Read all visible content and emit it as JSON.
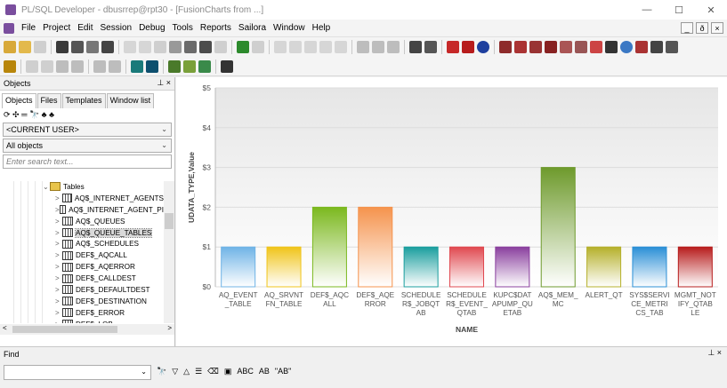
{
  "window": {
    "title": "PL/SQL Developer - dbusrrep@rpt30 - [FusionCharts from ...]"
  },
  "window_controls": [
    "—",
    "☐",
    "✕"
  ],
  "menu": [
    "File",
    "Project",
    "Edit",
    "Session",
    "Debug",
    "Tools",
    "Reports",
    "Sailora",
    "Window",
    "Help"
  ],
  "mdi_controls": [
    "_",
    "ð",
    "×"
  ],
  "objects_panel": {
    "title": "Objects",
    "pin": "⊥ ×",
    "tabs": [
      "Objects",
      "Files",
      "Templates",
      "Window list"
    ],
    "tools": "⟳ ✣ ═ 🔭 ♣ ♣",
    "user_combo": "<CURRENT USER>",
    "filter_combo": "All objects",
    "search_placeholder": "Enter search text...",
    "tree": [
      {
        "label": "Tables",
        "type": "folder",
        "expander": "⌄"
      },
      {
        "label": "AQ$_INTERNET_AGENTS",
        "expander": ">"
      },
      {
        "label": "AQ$_INTERNET_AGENT_PI",
        "expander": ">"
      },
      {
        "label": "AQ$_QUEUES",
        "expander": ">"
      },
      {
        "label": "AQ$_QUEUE_TABLES",
        "expander": ">",
        "selected": true
      },
      {
        "label": "AQ$_SCHEDULES",
        "expander": ">"
      },
      {
        "label": "DEF$_AQCALL",
        "expander": ">"
      },
      {
        "label": "DEF$_AQERROR",
        "expander": ">"
      },
      {
        "label": "DEF$_CALLDEST",
        "expander": ">"
      },
      {
        "label": "DEF$_DEFAULTDEST",
        "expander": ">"
      },
      {
        "label": "DEF$_DESTINATION",
        "expander": ">"
      },
      {
        "label": "DEF$_ERROR",
        "expander": ">"
      },
      {
        "label": "DEF$_LOB",
        "expander": ">"
      }
    ]
  },
  "find_panel": {
    "title": "Find",
    "pin": "⊥ ×",
    "tools": [
      "🔭",
      "▽",
      "△",
      "☰",
      "⌫",
      "▣",
      "ABC",
      "AB",
      "\"AB\""
    ]
  },
  "colors": {
    "grid": "#dcdcdc",
    "axis_text": "#555555",
    "series": [
      "#6fb3e6",
      "#f0c419",
      "#7bb81e",
      "#f5934d",
      "#1a9e9e",
      "#e0484f",
      "#8a3f9e",
      "#6e9a2c",
      "#b5b02a",
      "#2a8fd6",
      "#b71c1c"
    ]
  },
  "chart_data": {
    "type": "bar",
    "categories": [
      [
        "AQ_EVENT",
        "_TABLE"
      ],
      [
        "AQ_SRVNT",
        "FN_TABLE"
      ],
      [
        "DEF$_AQC",
        "ALL"
      ],
      [
        "DEF$_AQE",
        "RROR"
      ],
      [
        "SCHEDULE",
        "R$_JOBQT",
        "AB"
      ],
      [
        "SCHEDULE",
        "R$_EVENT_",
        "QTAB"
      ],
      [
        "KUPC$DAT",
        "APUMP_QU",
        "ETAB"
      ],
      [
        "AQ$_MEM_",
        "MC"
      ],
      [
        "ALERT_QT"
      ],
      [
        "SYS$SERVI",
        "CE_METRI",
        "CS_TAB"
      ],
      [
        "MGMT_NOT",
        "IFY_QTAB",
        "LE"
      ]
    ],
    "values": [
      1,
      1,
      2,
      2,
      1,
      1,
      1,
      3,
      1,
      1,
      1
    ],
    "xlabel": "NAME",
    "ylabel": "UDATA_TYPE,Value",
    "ylim": [
      0,
      5
    ],
    "yticks": [
      "$0",
      "$1",
      "$2",
      "$3",
      "$4",
      "$5"
    ],
    "grid": true,
    "legend": "none"
  }
}
